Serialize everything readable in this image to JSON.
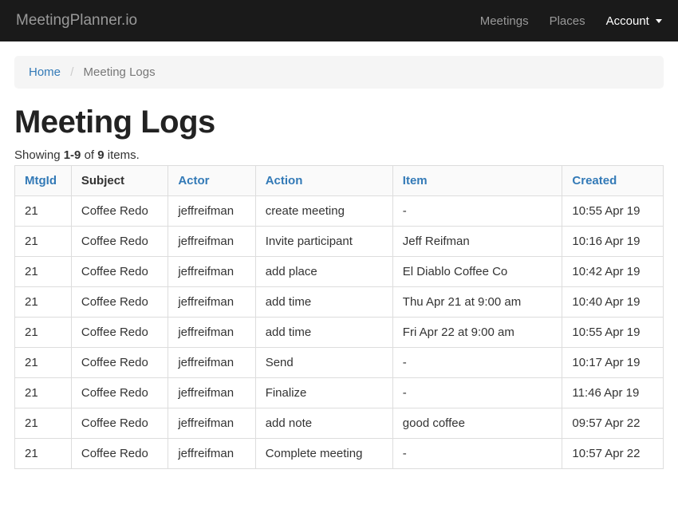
{
  "navbar": {
    "brand": "MeetingPlanner.io",
    "links": {
      "meetings": "Meetings",
      "places": "Places",
      "account": "Account"
    }
  },
  "breadcrumb": {
    "home": "Home",
    "current": "Meeting Logs"
  },
  "page": {
    "title": "Meeting Logs"
  },
  "summary": {
    "prefix": "Showing ",
    "range": "1-9",
    "mid": " of ",
    "total": "9",
    "suffix": " items."
  },
  "columns": {
    "mtgid": "MtgId",
    "subject": "Subject",
    "actor": "Actor",
    "action": "Action",
    "item": "Item",
    "created": "Created"
  },
  "rows": [
    {
      "mtgid": "21",
      "subject": "Coffee Redo",
      "actor": "jeffreifman",
      "action": "create meeting",
      "item": "-",
      "created": "10:55 Apr 19"
    },
    {
      "mtgid": "21",
      "subject": "Coffee Redo",
      "actor": "jeffreifman",
      "action": "Invite participant",
      "item": "Jeff Reifman",
      "created": "10:16 Apr 19"
    },
    {
      "mtgid": "21",
      "subject": "Coffee Redo",
      "actor": "jeffreifman",
      "action": "add place",
      "item": "El Diablo Coffee Co",
      "created": "10:42 Apr 19"
    },
    {
      "mtgid": "21",
      "subject": "Coffee Redo",
      "actor": "jeffreifman",
      "action": "add time",
      "item": "Thu Apr 21 at 9:00 am",
      "created": "10:40 Apr 19"
    },
    {
      "mtgid": "21",
      "subject": "Coffee Redo",
      "actor": "jeffreifman",
      "action": "add time",
      "item": "Fri Apr 22 at 9:00 am",
      "created": "10:55 Apr 19"
    },
    {
      "mtgid": "21",
      "subject": "Coffee Redo",
      "actor": "jeffreifman",
      "action": "Send",
      "item": "-",
      "created": "10:17 Apr 19"
    },
    {
      "mtgid": "21",
      "subject": "Coffee Redo",
      "actor": "jeffreifman",
      "action": "Finalize",
      "item": "-",
      "created": "11:46 Apr 19"
    },
    {
      "mtgid": "21",
      "subject": "Coffee Redo",
      "actor": "jeffreifman",
      "action": "add note",
      "item": "good coffee",
      "created": "09:57 Apr 22"
    },
    {
      "mtgid": "21",
      "subject": "Coffee Redo",
      "actor": "jeffreifman",
      "action": "Complete meeting",
      "item": "-",
      "created": "10:57 Apr 22"
    }
  ]
}
